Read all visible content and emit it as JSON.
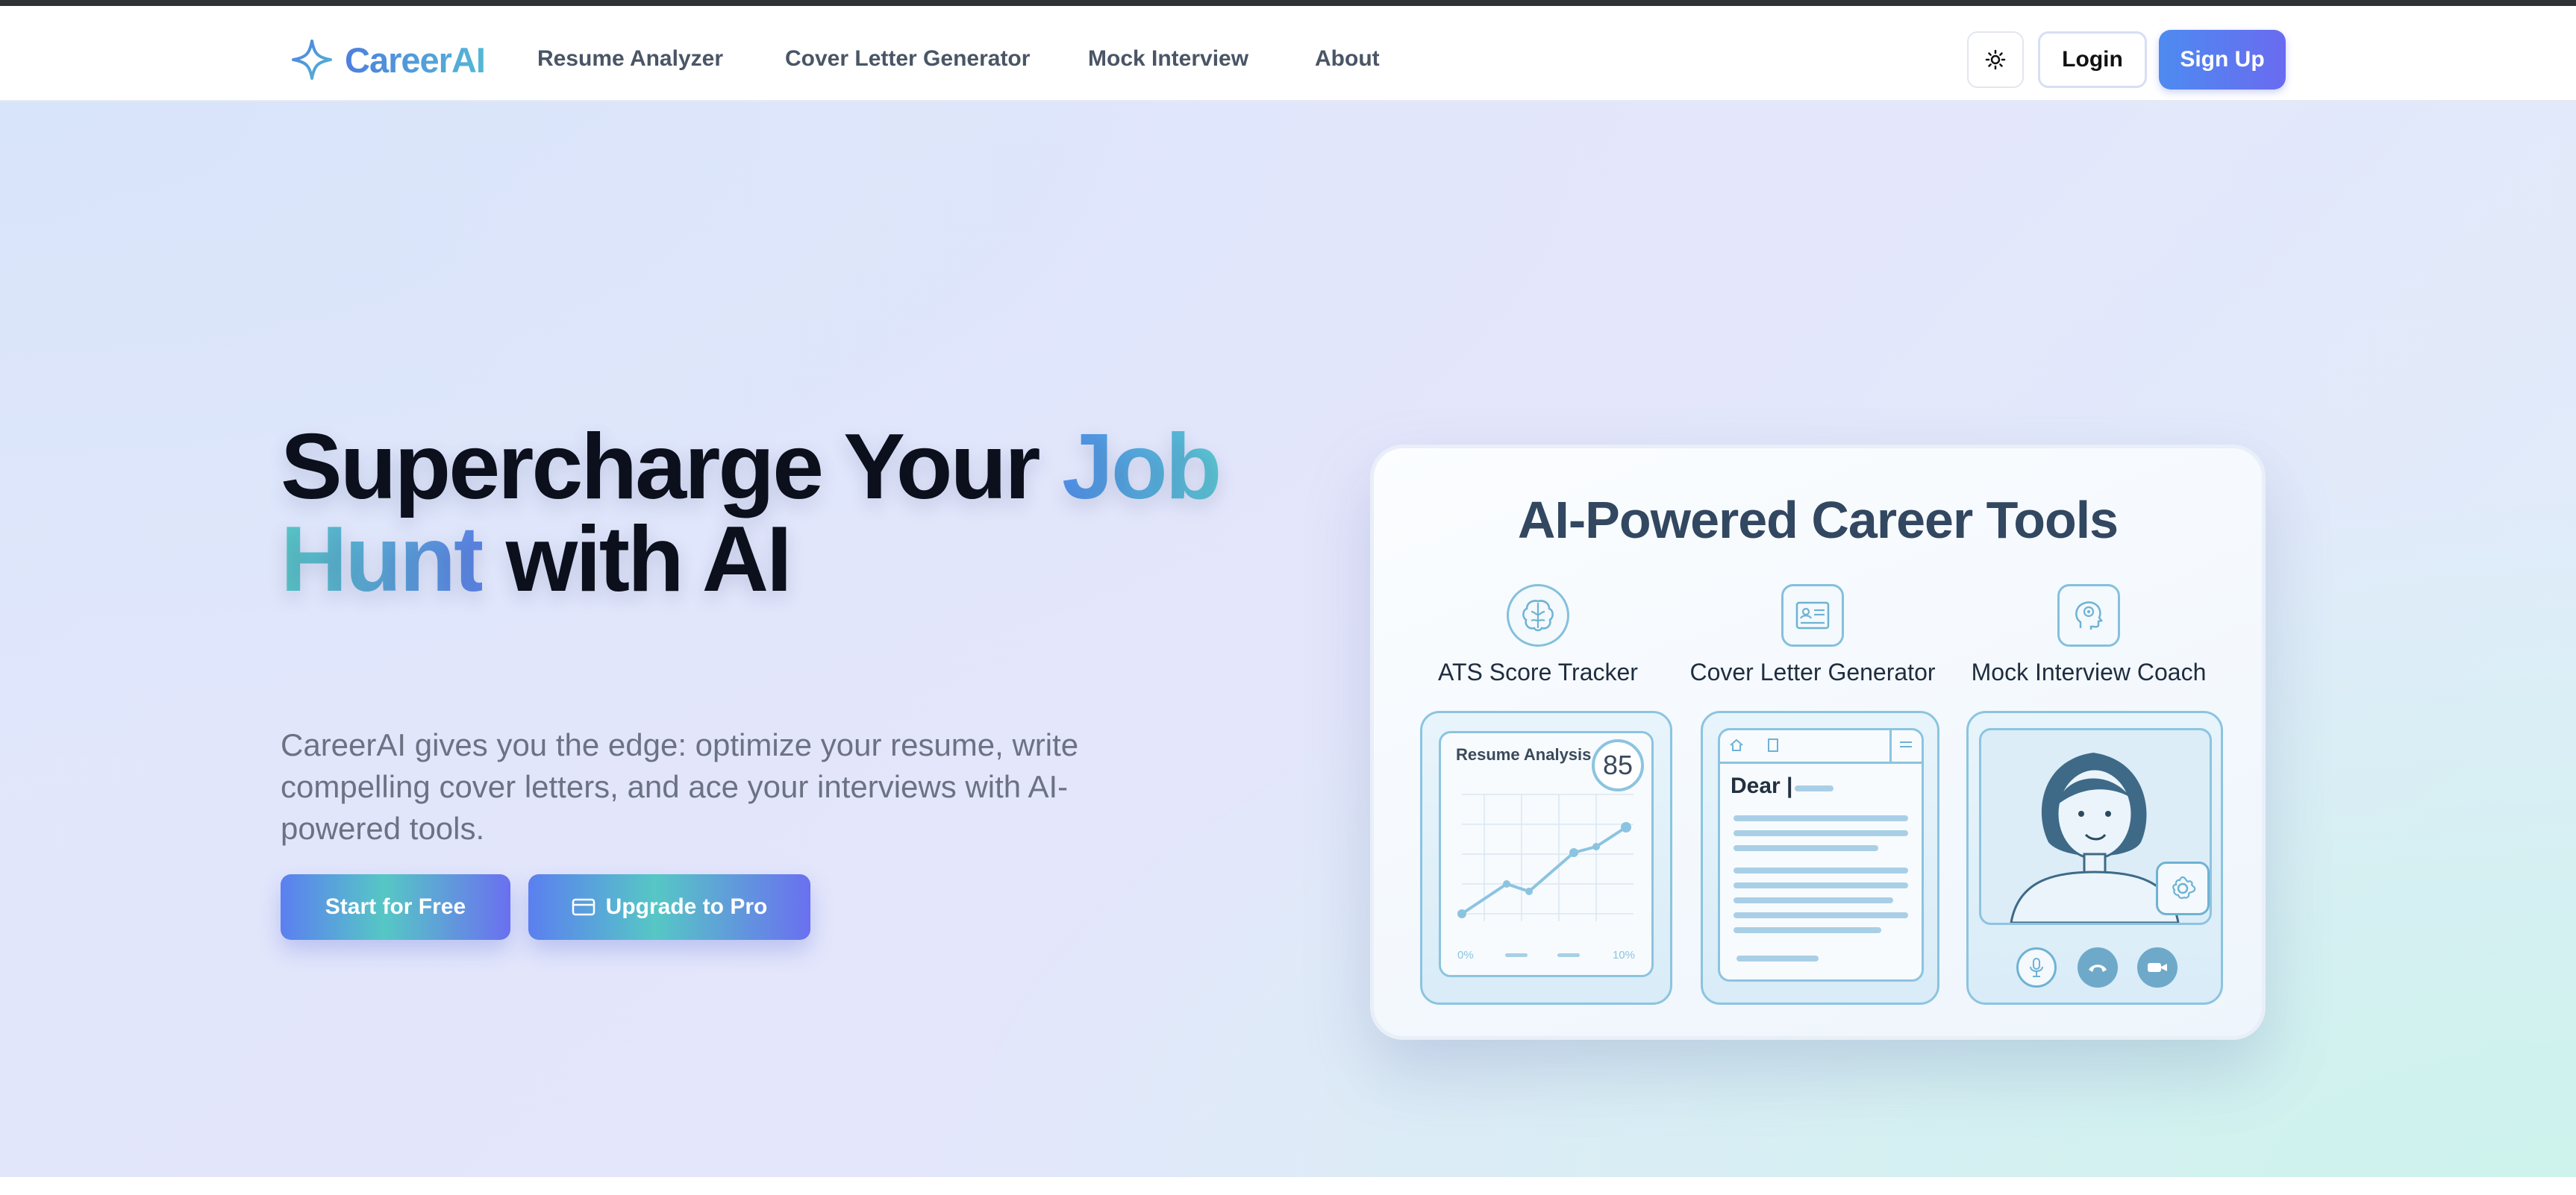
{
  "brand": {
    "name": "CareerAI",
    "logo_icon": "sparkle-icon",
    "accent": "#4d7fdf"
  },
  "nav": {
    "links": [
      "Resume Analyzer",
      "Cover Letter Generator",
      "Mock Interview",
      "About"
    ],
    "theme_toggle_icon": "sun-icon",
    "login_label": "Login",
    "signup_label": "Sign Up"
  },
  "hero": {
    "headline": {
      "part1": "Supercharge Your ",
      "highlight1": "Job",
      "highlight2": "Hunt",
      "part2": " with AI"
    },
    "subtext": "CareerAI gives you the edge: optimize your resume, write compelling cover letters, and ace your interviews with AI-powered tools.",
    "cta_primary": "Start for Free",
    "cta_secondary": "Upgrade to Pro",
    "cta_secondary_icon": "credit-card-icon"
  },
  "illustration": {
    "title": "AI-Powered Career Tools",
    "tools": [
      {
        "label": "ATS Score Tracker",
        "icon": "brain-icon"
      },
      {
        "label": "Cover Letter Generator",
        "icon": "id-card-icon"
      },
      {
        "label": "Mock Interview Coach",
        "icon": "head-gear-icon"
      }
    ],
    "resume_panel": {
      "title": "Resume Analysis",
      "score": "85",
      "axis_left": "0%",
      "axis_right": "10%"
    },
    "letter_panel": {
      "greeting": "Dear |"
    },
    "interview_panel": {
      "controls": [
        "microphone-icon",
        "hang-up-icon",
        "camera-icon"
      ]
    }
  }
}
